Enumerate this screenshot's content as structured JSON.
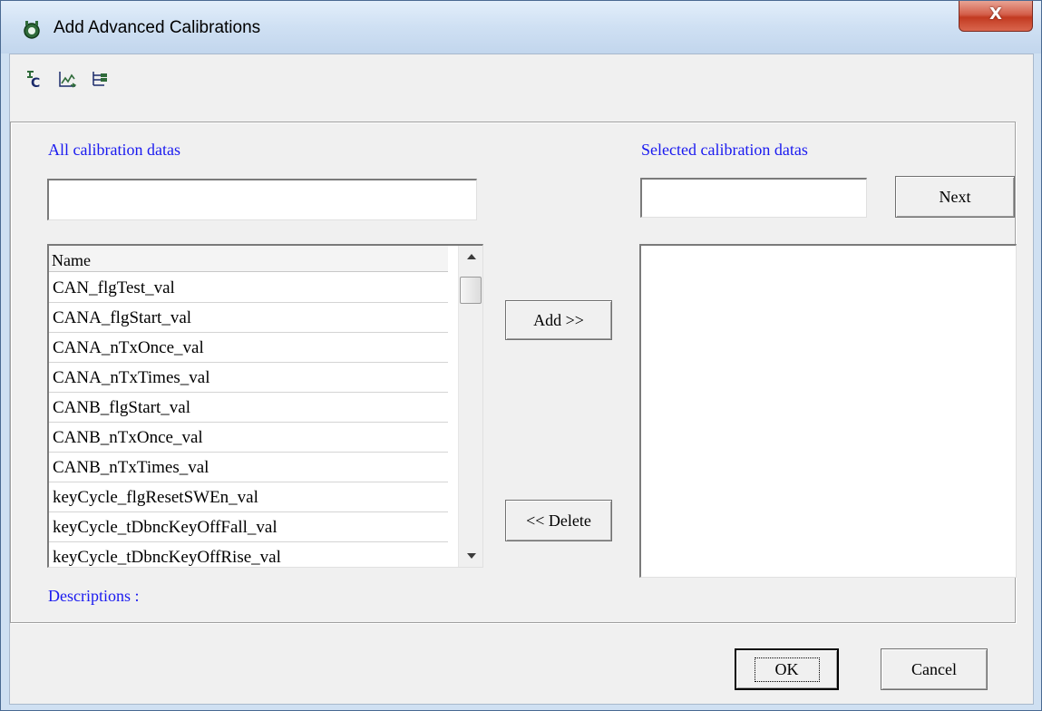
{
  "window": {
    "title": "Add Advanced Calibrations",
    "close_label": "X",
    "accent": "#cfe0f2",
    "close_color": "#c23a21"
  },
  "toolbar": {
    "icons": [
      "calibration-icon",
      "chart-icon",
      "tree-icon"
    ]
  },
  "left": {
    "label": "All calibration datas",
    "search_value": "",
    "list": {
      "header": "Name",
      "rows": [
        "CAN_flgTest_val",
        "CANA_flgStart_val",
        "CANA_nTxOnce_val",
        "CANA_nTxTimes_val",
        "CANB_flgStart_val",
        "CANB_nTxOnce_val",
        "CANB_nTxTimes_val",
        "keyCycle_flgResetSWEn_val",
        "keyCycle_tDbncKeyOffFall_val",
        "keyCycle_tDbncKeyOffRise_val"
      ]
    },
    "descriptions_label": "Descriptions :"
  },
  "middle": {
    "add_label": "Add >>",
    "delete_label": "<< Delete"
  },
  "right": {
    "label": "Selected calibration datas",
    "search_value": "",
    "next_label": "Next"
  },
  "footer": {
    "ok_label": "OK",
    "cancel_label": "Cancel"
  },
  "colors": {
    "label_blue": "#1a1af0",
    "dialog_bg": "#f0f0f0"
  }
}
